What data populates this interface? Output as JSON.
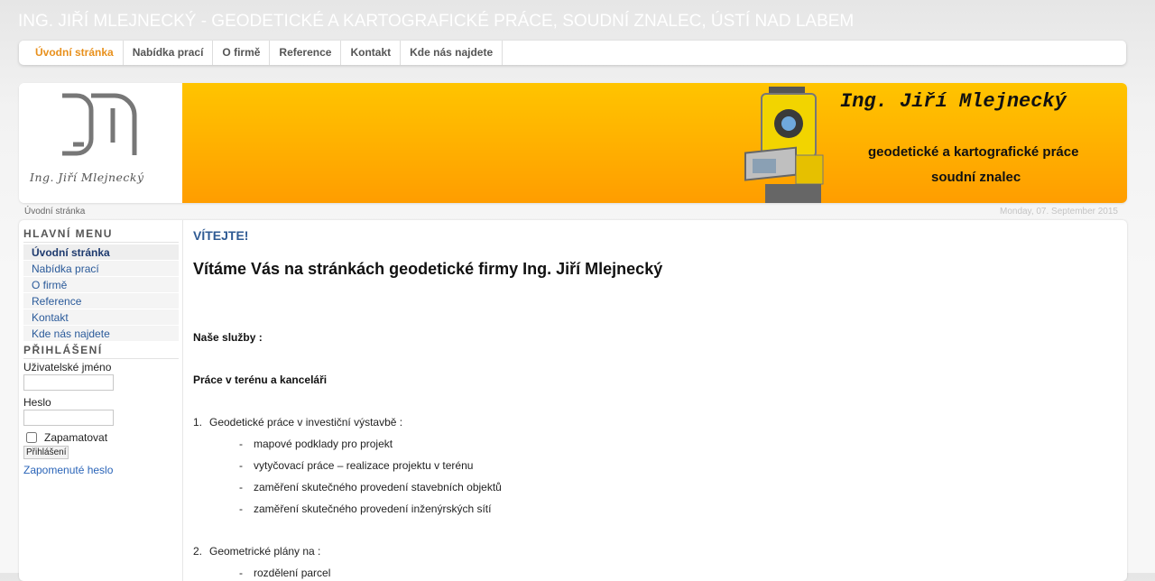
{
  "site": {
    "title": "ING. JIŘÍ MLEJNECKÝ - GEODETICKÉ A KARTOGRAFICKÉ PRÁCE, SOUDNÍ ZNALEC, ÚSTÍ NAD LABEM"
  },
  "topnav": {
    "items": [
      {
        "label": "Úvodní stránka",
        "active": true
      },
      {
        "label": "Nabídka prací"
      },
      {
        "label": "O firmě"
      },
      {
        "label": "Reference"
      },
      {
        "label": "Kontakt"
      },
      {
        "label": "Kde nás najdete"
      }
    ],
    "active_color": "#e8901c"
  },
  "banner": {
    "logo_signature": "Ing. Jiří Mlejnecký",
    "name": "Ing. Jiří Mlejnecký",
    "line1": "geodetické a kartografické práce",
    "line2": "soudní znalec"
  },
  "breadcrumb": "Úvodní stránka",
  "date": "Monday, 07. September 2015",
  "sidebar": {
    "menu_heading": "HLAVNÍ MENU",
    "menu": [
      {
        "label": "Úvodní stránka"
      },
      {
        "label": "Nabídka prací"
      },
      {
        "label": "O firmě"
      },
      {
        "label": "Reference"
      },
      {
        "label": "Kontakt"
      },
      {
        "label": "Kde nás najdete"
      }
    ],
    "login_heading": "PŘIHLÁŠENÍ",
    "username_label": "Uživatelské jméno",
    "username_value": "",
    "password_label": "Heslo",
    "password_value": "",
    "remember_label": "Zapamatovat",
    "login_button": "Přihlášení",
    "forgot_link": "Zapomenuté heslo"
  },
  "main": {
    "heading": "VÍTEJTE!",
    "title": "Vítáme Vás na stránkách geodetické firmy Ing. Jiří Mlejnecký",
    "services_label": "Naše služby :",
    "section_label": "Práce v terénu a kanceláři",
    "item1_num": "1.",
    "item1": "Geodetické práce v investiční výstavbě :",
    "bullets1": [
      "mapové podklady pro projekt",
      "vytyčovací práce – realizace projektu v terénu",
      "zaměření skutečného provedení stavebních objektů",
      "zaměření skutečného provedení inženýrských sítí"
    ],
    "item2_num": "2.",
    "item2": "Geometrické plány na :",
    "bullets2": [
      "rozdělení parcel"
    ],
    "dash": "-"
  },
  "colors": {
    "banner_orange_top": "#ffc400",
    "banner_orange_bottom": "#ff9d00",
    "heading_blue": "#2e5a93",
    "link_blue": "#2a64b8"
  }
}
